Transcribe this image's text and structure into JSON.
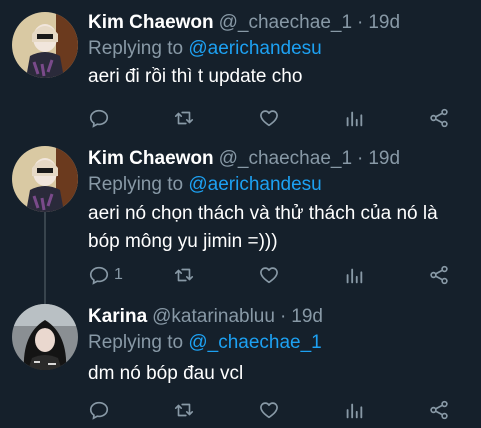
{
  "tweets": [
    {
      "name": "Kim Chaewon",
      "handle": "@_chaechae_1",
      "sep": "·",
      "time": "19d",
      "replying_label": "Replying to",
      "replying_to": "@aerichandesu",
      "text_lines": [
        "aeri đi rồi thì t update cho"
      ],
      "reply_count": "",
      "avatar": "chaewon-avatar"
    },
    {
      "name": "Kim Chaewon",
      "handle": "@_chaechae_1",
      "sep": "·",
      "time": "19d",
      "replying_label": "Replying to",
      "replying_to": "@aerichandesu",
      "text_lines": [
        "aeri nó chọn thách và thử thách của nó là",
        "bóp mông yu jimin =)))"
      ],
      "reply_count": "1",
      "avatar": "chaewon-avatar"
    },
    {
      "name": "Karina",
      "handle": "@katarinabluu",
      "sep": "·",
      "time": "19d",
      "replying_label": "Replying to",
      "replying_to": "@_chaechae_1",
      "text_lines": [
        "dm nó bóp đau vcl"
      ],
      "reply_count": "",
      "avatar": "karina-avatar"
    }
  ],
  "icons": [
    "reply-icon",
    "retweet-icon",
    "like-icon",
    "analytics-icon",
    "share-icon"
  ],
  "colors": {
    "background": "#15202b",
    "secondary": "#8899a6",
    "accent": "#1da1f2",
    "divider": "#38444d"
  }
}
